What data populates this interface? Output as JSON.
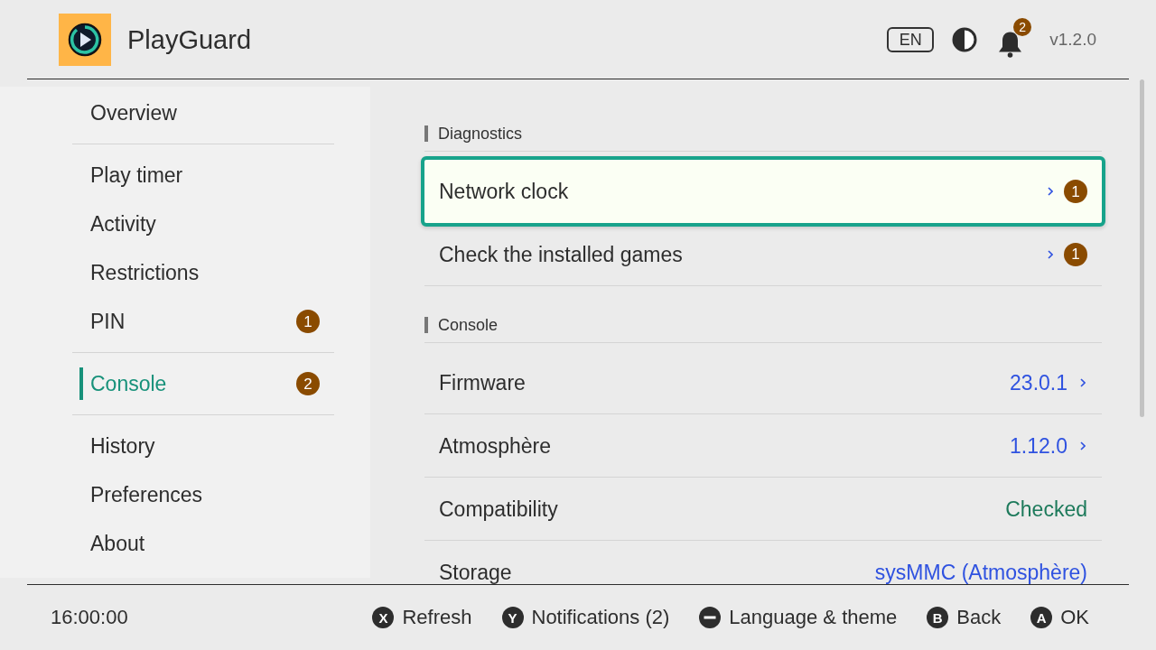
{
  "app": {
    "title": "PlayGuard"
  },
  "header": {
    "language": "EN",
    "notifications": "2",
    "version": "v1.2.0"
  },
  "sidebar": {
    "groups": [
      {
        "items": [
          {
            "label": "Overview",
            "selected": false
          }
        ]
      },
      {
        "items": [
          {
            "label": "Play timer",
            "selected": false
          },
          {
            "label": "Activity",
            "selected": false
          },
          {
            "label": "Restrictions",
            "selected": false
          },
          {
            "label": "PIN",
            "selected": false,
            "badge": "1"
          }
        ]
      },
      {
        "items": [
          {
            "label": "Console",
            "selected": true,
            "badge": "2"
          }
        ]
      },
      {
        "items": [
          {
            "label": "History",
            "selected": false
          },
          {
            "label": "Preferences",
            "selected": false
          },
          {
            "label": "About",
            "selected": false
          }
        ]
      }
    ]
  },
  "content": {
    "sections": [
      {
        "title": "Diagnostics",
        "rows": [
          {
            "kind": "link",
            "label": "Network clock",
            "selected": true,
            "badge": "1"
          },
          {
            "kind": "link",
            "label": "Check the installed games",
            "selected": false,
            "badge": "1"
          }
        ]
      },
      {
        "title": "Console",
        "rows": [
          {
            "kind": "link",
            "label": "Firmware",
            "value": "23.0.1",
            "selected": false
          },
          {
            "kind": "link",
            "label": "Atmosphère",
            "value": "1.12.0",
            "selected": false
          },
          {
            "kind": "status",
            "label": "Compatibility",
            "value": "Checked",
            "selected": false
          },
          {
            "kind": "info",
            "label": "Storage",
            "value": "sysMMC (Atmosphère)",
            "selected": false
          }
        ]
      }
    ]
  },
  "footer": {
    "clock": "16:00:00",
    "hints": [
      {
        "kind": "letter",
        "key": "X",
        "label": "Refresh"
      },
      {
        "kind": "letter",
        "key": "Y",
        "label": "Notifications (2)"
      },
      {
        "kind": "minus",
        "label": "Language & theme"
      },
      {
        "kind": "letter",
        "key": "B",
        "label": "Back"
      },
      {
        "kind": "letter",
        "key": "A",
        "label": "OK"
      }
    ]
  }
}
